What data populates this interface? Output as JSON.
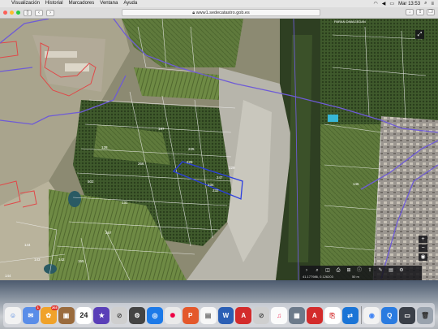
{
  "menubar": {
    "items": [
      "Visualización",
      "Historial",
      "Marcadores",
      "Ventana",
      "Ayuda"
    ],
    "clock": "Mar 13:53"
  },
  "browser": {
    "url": "www1.sedecatastro.gob.es"
  },
  "map": {
    "top_label": "PARAN DIMAGEDAN",
    "parcel_numbers": [
      "225",
      "226",
      "247",
      "229",
      "232",
      "234",
      "502",
      "131",
      "367",
      "144",
      "143",
      "142",
      "155",
      "144",
      "197",
      "128",
      "266",
      "146"
    ],
    "coords_label": "41.177986, 0.126203"
  },
  "maptools": {
    "scale_label": "50 m"
  },
  "dock": {
    "badge_mail": "1",
    "badge_photos": "203",
    "calendar_day": "24"
  }
}
